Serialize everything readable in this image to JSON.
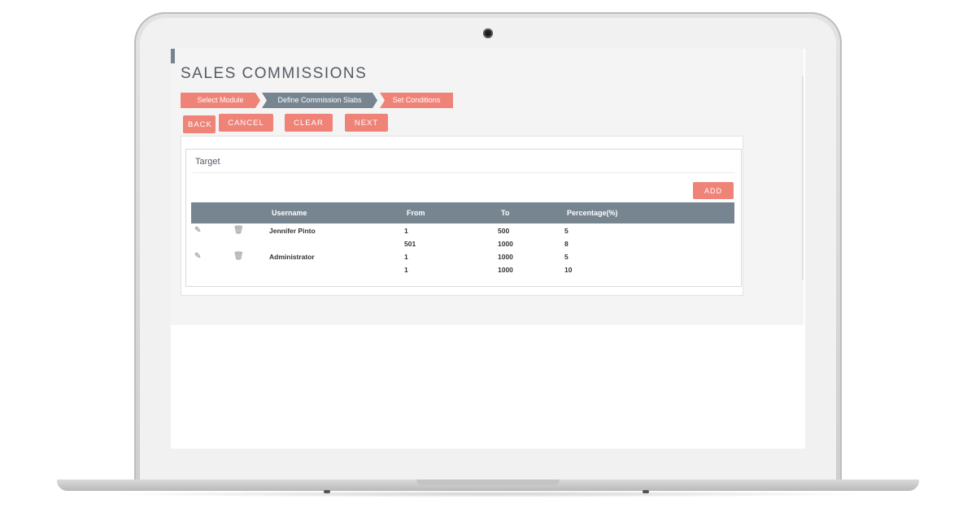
{
  "app": {
    "title": "SALES COMMISSIONS"
  },
  "steps": [
    {
      "label": "Select Module",
      "state": "done"
    },
    {
      "label": "Define Commission Slabs",
      "state": "active"
    },
    {
      "label": "Set Conditions",
      "state": "pending"
    }
  ],
  "actions": {
    "back": "BACK",
    "cancel": "CANCEL",
    "clear": "CLEAR",
    "next": "NEXT"
  },
  "panel": {
    "title": "Target",
    "add_label": "ADD"
  },
  "table": {
    "columns": [
      "Username",
      "From",
      "To",
      "Percentage(%)"
    ],
    "rows": [
      {
        "username": "Jennifer Pinto",
        "from": "1",
        "to": "500",
        "percentage": "5",
        "has_actions": true
      },
      {
        "username": "",
        "from": "501",
        "to": "1000",
        "percentage": "8",
        "has_actions": false
      },
      {
        "username": "Administrator",
        "from": "1",
        "to": "1000",
        "percentage": "5",
        "has_actions": true
      },
      {
        "username": "",
        "from": "1",
        "to": "1000",
        "percentage": "10",
        "has_actions": false
      }
    ]
  },
  "icons": {
    "edit": "pencil-icon",
    "delete": "trash-icon"
  },
  "colors": {
    "accent": "#f08377",
    "header": "#778591",
    "text": "#555a63"
  }
}
